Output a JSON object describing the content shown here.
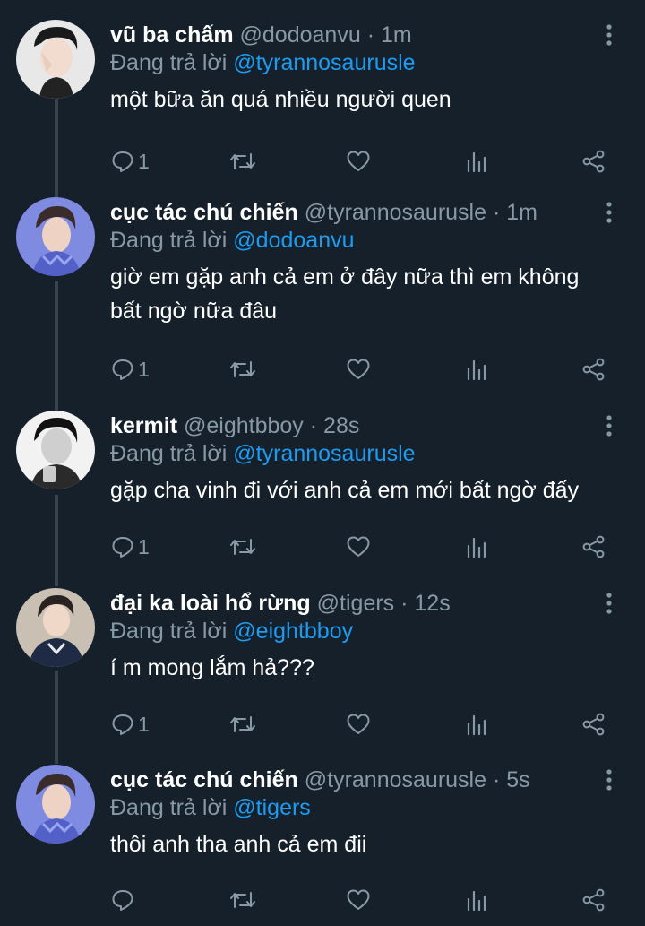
{
  "colors": {
    "background": "#15202b",
    "muted": "#8899a6",
    "link": "#1d9bf0",
    "thread_line": "#38444d"
  },
  "tweets": [
    {
      "display_name": "vũ ba chấm",
      "handle": "@dodoanvu",
      "time": "1m",
      "reply_prefix": "Đang trả lời",
      "reply_to": "@tyrannosaurusle",
      "text": "một bữa ăn quá nhiều người quen",
      "reply_count": "1"
    },
    {
      "display_name": "cục tác chú chiến",
      "handle": "@tyrannosaurusle",
      "time": "1m",
      "reply_prefix": "Đang trả lời",
      "reply_to": "@dodoanvu",
      "text": "giờ em gặp anh cả em ở đây nữa thì em không bất ngờ nữa đâu",
      "reply_count": "1"
    },
    {
      "display_name": "kermit",
      "handle": "@eightbboy",
      "time": "28s",
      "reply_prefix": "Đang trả lời",
      "reply_to": "@tyrannosaurusle",
      "text": "gặp cha vinh đi với anh cả em mới bất ngờ đấy",
      "reply_count": "1"
    },
    {
      "display_name": "đại ka loài hổ rừng",
      "handle": "@tigers",
      "time": "12s",
      "reply_prefix": "Đang trả lời",
      "reply_to": "@eightbboy",
      "text": "í m mong lắm hả???",
      "reply_count": "1"
    },
    {
      "display_name": "cục tác chú chiến",
      "handle": "@tyrannosaurusle",
      "time": "5s",
      "reply_prefix": "Đang trả lời",
      "reply_to": "@tigers",
      "text": "thôi anh tha anh cả em đii",
      "reply_count": ""
    }
  ],
  "icons": {
    "reply": "speech-bubble-icon",
    "retweet": "retweet-arrows-icon",
    "like": "heart-icon",
    "views": "bar-chart-icon",
    "share": "share-nodes-icon",
    "more": "vertical-ellipsis-icon"
  }
}
